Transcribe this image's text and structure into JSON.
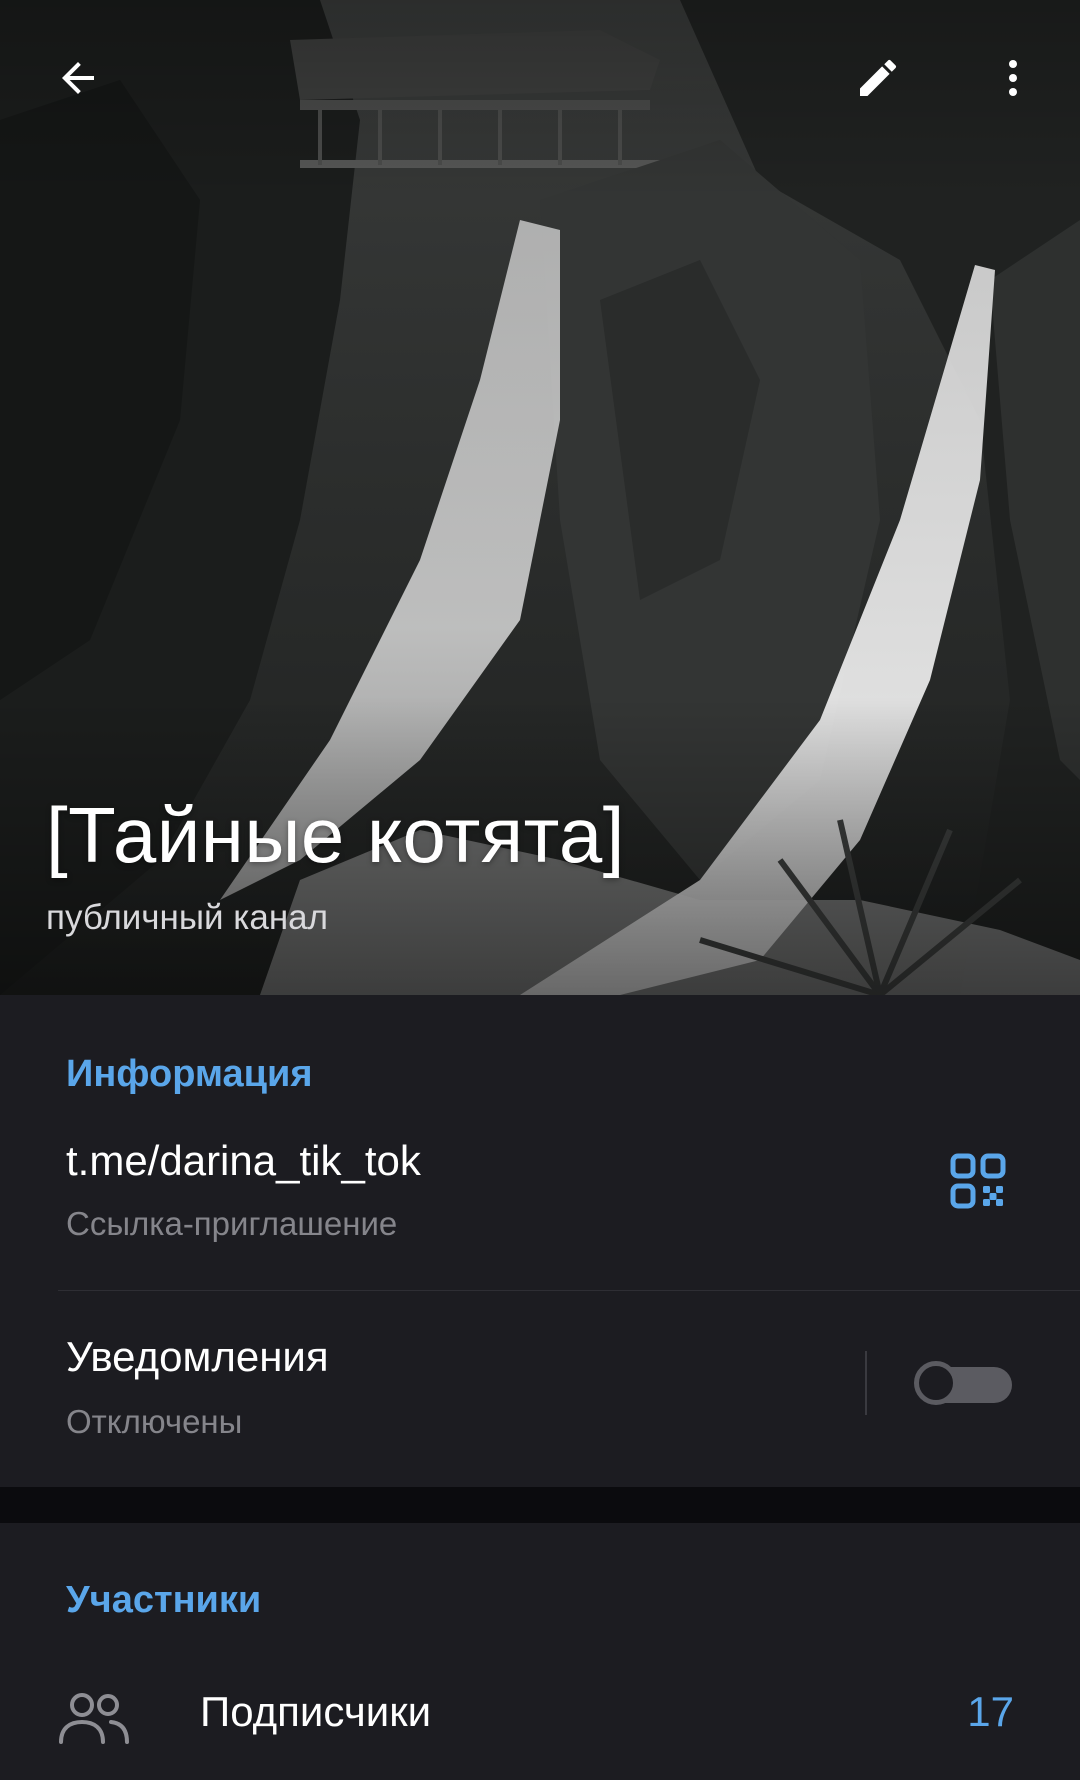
{
  "header": {
    "title": "[Тайные котята]",
    "subtitle": "публичный канал",
    "icons": [
      "arrow-back-icon",
      "pencil-icon",
      "more-vert-icon"
    ]
  },
  "info": {
    "section_title": "Информация",
    "link": {
      "value": "t.me/darina_tik_tok",
      "label": "Ссылка-приглашение",
      "icon": "qr-code-icon"
    },
    "notifications": {
      "title": "Уведомления",
      "status": "Отключены",
      "enabled": false
    }
  },
  "members": {
    "section_title": "Участники",
    "subscribers": {
      "label": "Подписчики",
      "count": "17",
      "icon": "users-icon"
    }
  },
  "colors": {
    "accent": "#5aa6ea",
    "section_bg": "#1c1c21",
    "page_bg": "#0b0b0e",
    "secondary_text": "#85858b"
  }
}
